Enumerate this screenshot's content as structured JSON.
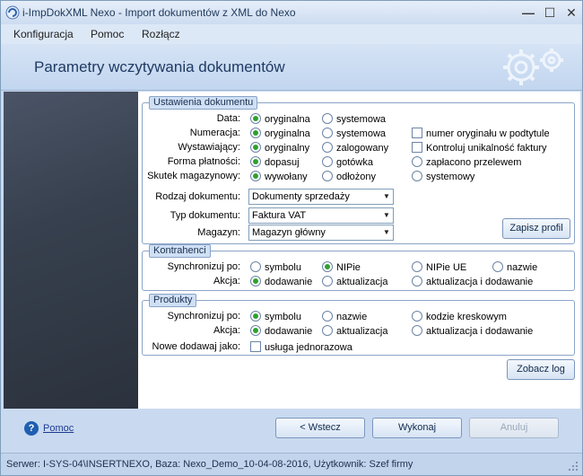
{
  "window": {
    "title": "i-ImpDokXML Nexo - Import dokumentów z XML do Nexo",
    "minimize_glyph": "—",
    "maximize_glyph": "☐",
    "close_glyph": "✕"
  },
  "menu": {
    "items": [
      "Konfiguracja",
      "Pomoc",
      "Rozłącz"
    ]
  },
  "header": {
    "title": "Parametry wczytywania dokumentów"
  },
  "dokument": {
    "title": "Ustawienia dokumentu",
    "labels": {
      "data": "Data:",
      "numeracja": "Numeracja:",
      "wystawiajacy": "Wystawiający:",
      "forma": "Forma płatności:",
      "skutek": "Skutek magazynowy:",
      "rodzaj": "Rodzaj dokumentu:",
      "typ": "Typ dokumentu:",
      "magazyn": "Magazyn:"
    },
    "data_opts": [
      "oryginalna",
      "systemowa"
    ],
    "numeracja_opts": [
      "oryginalna",
      "systemowa"
    ],
    "wystawiajacy_opts": [
      "oryginalny",
      "zalogowany"
    ],
    "forma_opts": [
      "dopasuj",
      "gotówka",
      "zapłacono przelewem"
    ],
    "skutek_opts": [
      "wywołany",
      "odłożony",
      "systemowy"
    ],
    "check_podtytul": "numer oryginału w podtytule",
    "check_unikalnosc": "Kontroluj unikalność faktury",
    "rodzaj_value": "Dokumenty sprzedaży",
    "typ_value": "Faktura VAT",
    "magazyn_value": "Magazyn główny",
    "zapisz_label": "Zapisz profil"
  },
  "kontrahenci": {
    "title": "Kontrahenci",
    "sync_label": "Synchronizuj po:",
    "akcja_label": "Akcja:",
    "sync_opts": [
      "symbolu",
      "NIPie",
      "NIPie UE",
      "nazwie"
    ],
    "akcja_opts": [
      "dodawanie",
      "aktualizacja",
      "aktualizacja i dodawanie"
    ]
  },
  "produkty": {
    "title": "Produkty",
    "sync_label": "Synchronizuj po:",
    "akcja_label": "Akcja:",
    "nowe_label": "Nowe dodawaj jako:",
    "sync_opts": [
      "symbolu",
      "nazwie",
      "kodzie kreskowym"
    ],
    "akcja_opts": [
      "dodawanie",
      "aktualizacja",
      "aktualizacja i dodawanie"
    ],
    "nowe_check": "usługa jednorazowa"
  },
  "zobacz_label": "Zobacz log",
  "footer": {
    "help_glyph": "?",
    "help_label": "Pomoc",
    "back_label": "<  Wstecz",
    "run_label": "Wykonaj",
    "cancel_label": "Anuluj"
  },
  "status": {
    "text": "Serwer: I-SYS-04\\INSERTNEXO, Baza: Nexo_Demo_10-04-08-2016, Użytkownik: Szef firmy"
  }
}
